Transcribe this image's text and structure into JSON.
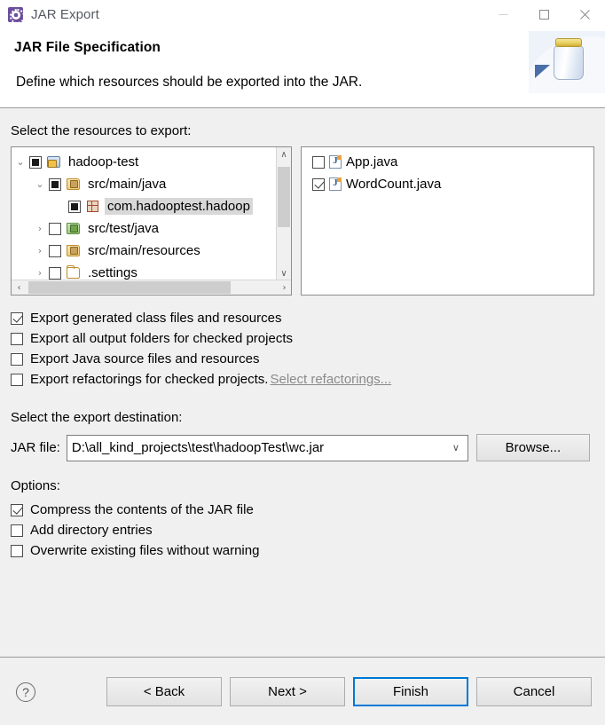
{
  "window": {
    "title": "JAR Export",
    "icon": "gear-icon",
    "controls": {
      "minimize": "—",
      "maximize": "□",
      "close": "✕"
    }
  },
  "header": {
    "title": "JAR File Specification",
    "description": "Define which resources should be exported into the JAR.",
    "illustration": "jar-with-arrow-icon"
  },
  "resources": {
    "label": "Select the resources to export:",
    "tree": [
      {
        "label": "hadoop-test",
        "indent": 0,
        "twisty": "⌄",
        "check": "grayed",
        "icon": "project-folder-icon",
        "selected": false
      },
      {
        "label": "src/main/java",
        "indent": 1,
        "twisty": "⌄",
        "check": "grayed",
        "icon": "source-folder-icon",
        "selected": false
      },
      {
        "label": "com.hadooptest.hadoop",
        "indent": 2,
        "twisty": "",
        "check": "grayed",
        "icon": "package-icon",
        "selected": true
      },
      {
        "label": "src/test/java",
        "indent": 1,
        "twisty": "›",
        "check": "unchecked",
        "icon": "test-source-folder-icon",
        "selected": false
      },
      {
        "label": "src/main/resources",
        "indent": 1,
        "twisty": "›",
        "check": "unchecked",
        "icon": "source-folder-icon",
        "selected": false
      },
      {
        "label": ".settings",
        "indent": 1,
        "twisty": "›",
        "check": "unchecked",
        "icon": "plain-folder-icon",
        "selected": false
      }
    ],
    "files": [
      {
        "label": "App.java",
        "check": "unchecked",
        "icon": "java-file-icon"
      },
      {
        "label": "WordCount.java",
        "check": "checked",
        "icon": "java-file-icon"
      }
    ],
    "scroll": {
      "up": "∧",
      "down": "∨",
      "left": "‹",
      "right": "›"
    }
  },
  "export_options": [
    {
      "label": "Export generated class files and resources",
      "check": "checked",
      "link": ""
    },
    {
      "label": "Export all output folders for checked projects",
      "check": "unchecked",
      "link": ""
    },
    {
      "label": "Export Java source files and resources",
      "check": "unchecked",
      "link": ""
    },
    {
      "label": "Export refactorings for checked projects.",
      "check": "unchecked",
      "link": "Select refactorings..."
    }
  ],
  "destination": {
    "label": "Select the export destination:",
    "field_label": "JAR file:",
    "value": "D:\\all_kind_projects\\test\\hadoopTest\\wc.jar",
    "caret": "∨",
    "browse_label": "Browse..."
  },
  "options": {
    "label": "Options:",
    "items": [
      {
        "label": "Compress the contents of the JAR file",
        "check": "checked"
      },
      {
        "label": "Add directory entries",
        "check": "unchecked"
      },
      {
        "label": "Overwrite existing files without warning",
        "check": "unchecked"
      }
    ]
  },
  "footer": {
    "help": "?",
    "buttons": [
      {
        "label": "< Back",
        "primary": false
      },
      {
        "label": "Next >",
        "primary": false
      },
      {
        "label": "Finish",
        "primary": true
      },
      {
        "label": "Cancel",
        "primary": false
      }
    ]
  },
  "colors": {
    "accent": "#0078d7",
    "window_bg": "#f0f0f0",
    "panel_bg": "#ffffff",
    "link_disabled": "#8a8a8a"
  }
}
